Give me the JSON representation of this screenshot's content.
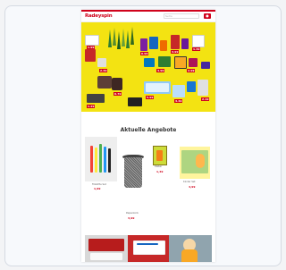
{
  "header": {
    "logo": "Radeyspin",
    "search_placeholder": "Suche",
    "cart_icon": "cart-icon"
  },
  "hero": {
    "prices": [
      "1.99",
      "2.49",
      "0.99",
      "3.99",
      "1.49",
      "4.99",
      "2.99",
      "0.79",
      "1.29",
      "5.99",
      "3.49",
      "2.19"
    ]
  },
  "section": {
    "title": "Aktuelle Angebote"
  },
  "products": [
    {
      "name": "Filzstifte Set",
      "price": "1,99"
    },
    {
      "name": "Papierkorb",
      "price": "3,99"
    },
    {
      "name": "Kleber",
      "price": "1,49"
    },
    {
      "name": "Kinder Set",
      "price": "4,99"
    }
  ],
  "colors": {
    "brand": "#d0021b",
    "hero_bg": "#f3e312"
  }
}
